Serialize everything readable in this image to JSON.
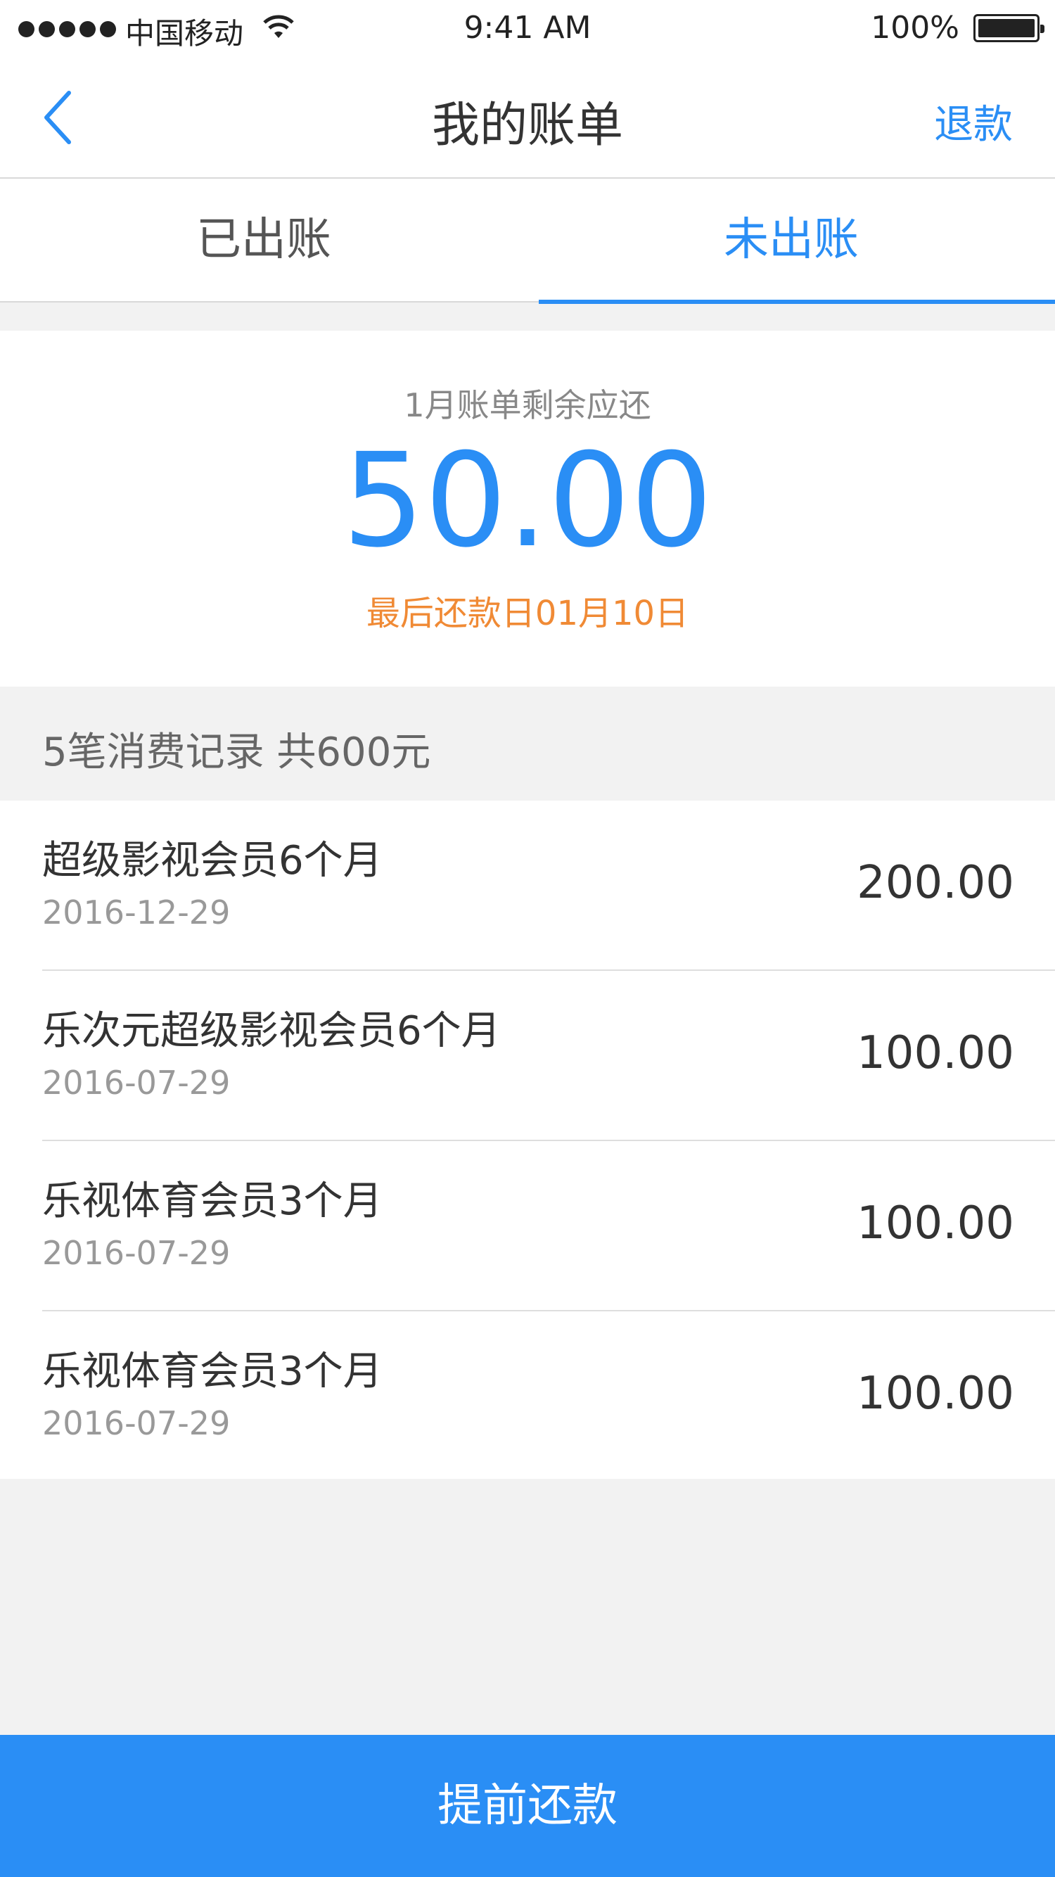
{
  "status_bar": {
    "carrier": "中国移动",
    "time": "9:41 AM",
    "battery": "100%"
  },
  "nav": {
    "title": "我的账单",
    "right_action": "退款"
  },
  "tabs": [
    {
      "label": "已出账",
      "active": false
    },
    {
      "label": "未出账",
      "active": true
    }
  ],
  "summary": {
    "label": "1月账单剩余应还",
    "amount": "50.00",
    "due_date": "最后还款日01月10日"
  },
  "records_header": "5笔消费记录  共600元",
  "records": [
    {
      "name": "超级影视会员6个月",
      "date": "2016-12-29",
      "amount": "200.00"
    },
    {
      "name": "乐次元超级影视会员6个月",
      "date": "2016-07-29",
      "amount": "100.00"
    },
    {
      "name": "乐视体育会员3个月",
      "date": "2016-07-29",
      "amount": "100.00"
    },
    {
      "name": "乐视体育会员3个月",
      "date": "2016-07-29",
      "amount": "100.00"
    }
  ],
  "cta": {
    "label": "提前还款"
  },
  "colors": {
    "accent": "#2a8ef5",
    "due": "#f08a35"
  }
}
